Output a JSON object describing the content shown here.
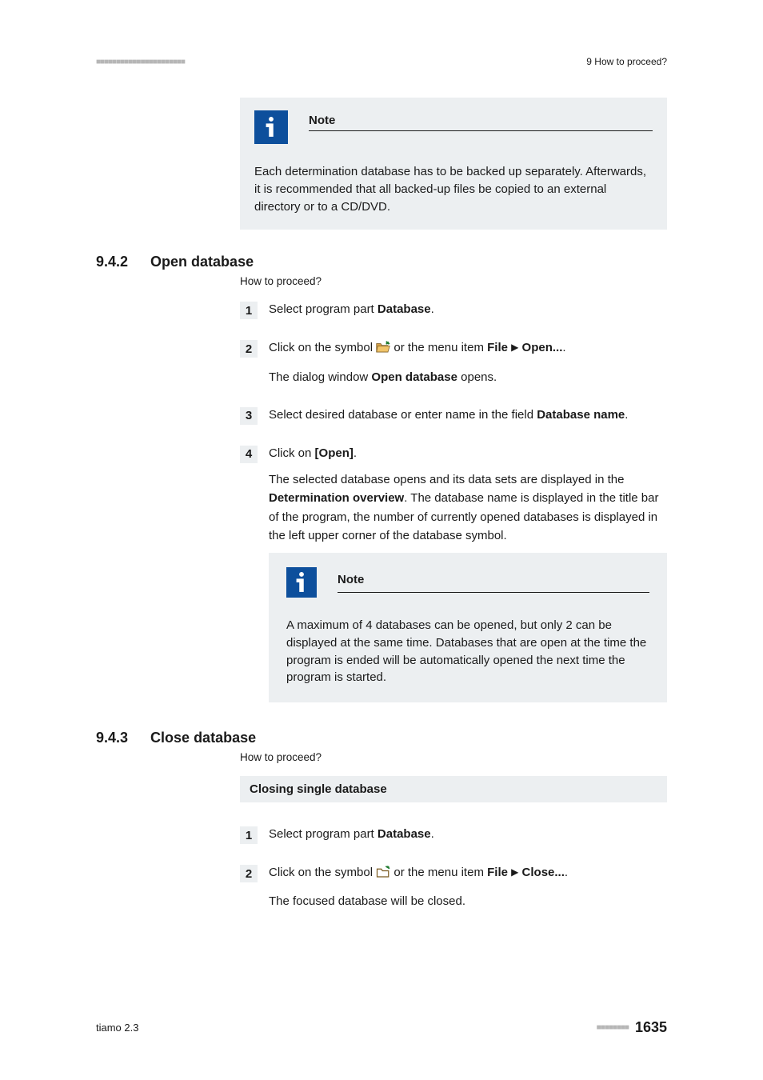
{
  "header": {
    "dot_placeholder": "■■■■■■■■■■■■■■■■■■■■■■",
    "running_head": "9 How to proceed?"
  },
  "note1": {
    "title": "Note",
    "text": "Each determination database has to be backed up separately. Afterwards, it is recommended that all backed-up files be copied to an external directory or to a CD/DVD."
  },
  "section942": {
    "number": "9.4.2",
    "title": "Open database",
    "subtitle": "How to proceed?",
    "steps": {
      "s1": {
        "num": "1",
        "text_a": "Select program part ",
        "bold_a": "Database",
        "text_b": "."
      },
      "s2": {
        "num": "2",
        "text_a": "Click on the symbol ",
        "text_b": " or the menu item ",
        "bold_b": "File",
        "bold_c": "Open...",
        "text_c": ".",
        "result_a": "The dialog window ",
        "result_bold": "Open database",
        "result_b": " opens."
      },
      "s3": {
        "num": "3",
        "text_a": "Select desired database or enter name in the field ",
        "bold_a": "Database name",
        "text_b": "."
      },
      "s4": {
        "num": "4",
        "text_a": "Click on ",
        "bold_a": "[Open]",
        "text_b": ".",
        "result_a": "The selected database opens and its data sets are displayed in the ",
        "result_bold": "Determination overview",
        "result_b": ". The database name is displayed in the title bar of the program, the number of currently opened databases is displayed in the left upper corner of the database symbol."
      }
    },
    "note2": {
      "title": "Note",
      "text": "A maximum of 4 databases can be opened, but only 2 can be displayed at the same time. Databases that are open at the time the program is ended will be automatically opened the next time the program is started."
    }
  },
  "section943": {
    "number": "9.4.3",
    "title": "Close database",
    "subtitle": "How to proceed?",
    "bar": "Closing single database",
    "steps": {
      "s1": {
        "num": "1",
        "text_a": "Select program part ",
        "bold_a": "Database",
        "text_b": "."
      },
      "s2": {
        "num": "2",
        "text_a": "Click on the symbol ",
        "text_b": " or the menu item ",
        "bold_b": "File",
        "bold_c": "Close...",
        "text_c": ".",
        "result": "The focused database will be closed."
      }
    }
  },
  "footer": {
    "left": "tiamo 2.3",
    "dots": "■■■■■■■■",
    "page": "1635"
  }
}
